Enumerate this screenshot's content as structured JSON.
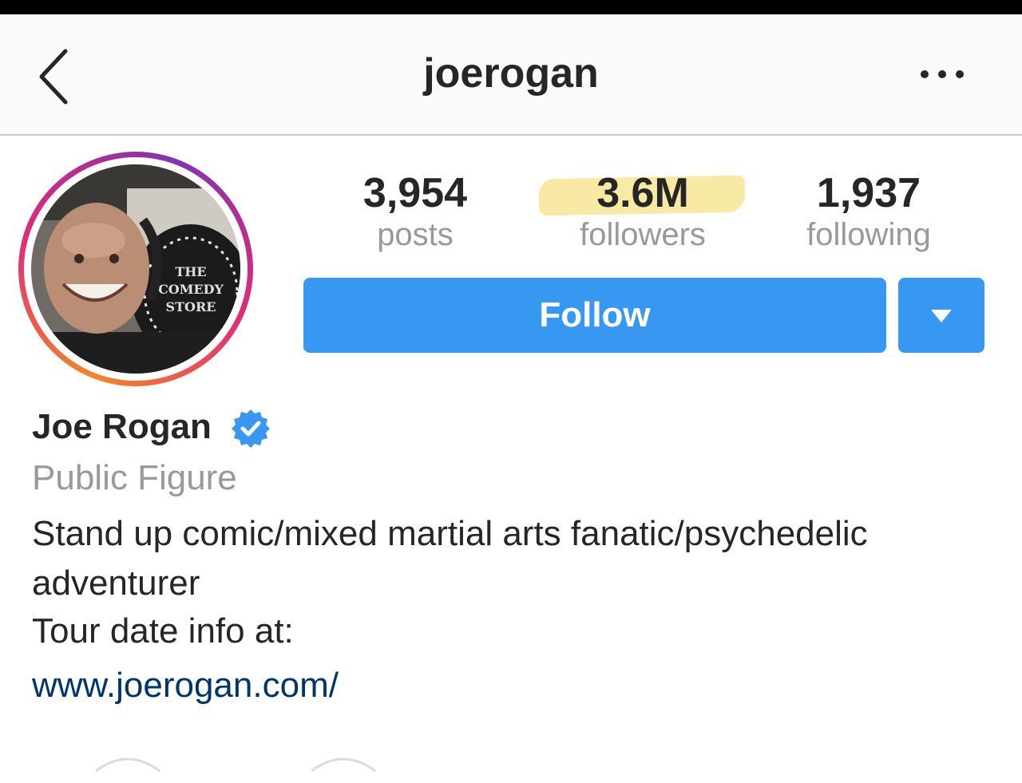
{
  "header": {
    "username": "joerogan"
  },
  "stats": {
    "posts": {
      "value": "3,954",
      "label": "posts"
    },
    "followers": {
      "value": "3.6M",
      "label": "followers"
    },
    "following": {
      "value": "1,937",
      "label": "following"
    }
  },
  "actions": {
    "follow_label": "Follow"
  },
  "profile": {
    "full_name": "Joe Rogan",
    "category": "Public Figure",
    "bio": "Stand up comic/mixed martial arts fanatic/psychedelic adventurer",
    "tour_info": "Tour date info at:",
    "website": "www.joerogan.com/",
    "avatar_sign_text": "THE COMEDY STORE"
  },
  "icons": {
    "back": "chevron-left-icon",
    "more": "more-horizontal-icon",
    "verified": "verified-badge-icon",
    "dropdown": "caret-down-icon"
  },
  "colors": {
    "follow_blue": "#3897f0",
    "link": "#003569",
    "secondary_text": "#999999",
    "highlight": "#f6e58d"
  }
}
